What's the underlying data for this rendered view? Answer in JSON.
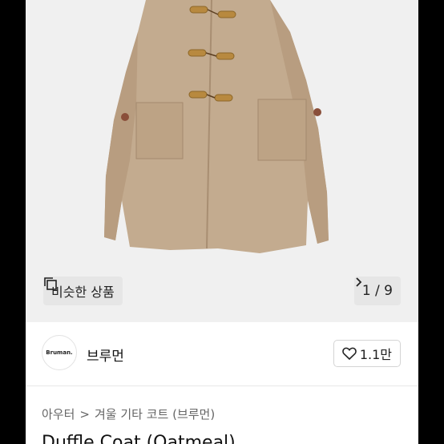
{
  "product": {
    "similar_button_label": "비슷한 상품",
    "pager": "1 / 9",
    "title": "Duffle Coat (Oatmeal)"
  },
  "seller": {
    "logo_text": "Bruman.",
    "name": "브루먼",
    "like_count": "1.1만"
  },
  "breadcrumb": {
    "items": [
      "아우터",
      "겨울 기타 코트 (브루먼)"
    ],
    "separator": ">"
  },
  "icons": {
    "similar": "squares-icon",
    "pager_next": "chevron-right-icon",
    "like": "heart-outline-icon",
    "breadcrumb_separator": "chevron-right-icon"
  },
  "colors": {
    "coat": "#c3ab8f",
    "toggles": "#b8893f",
    "background": "#f0f0f0"
  }
}
